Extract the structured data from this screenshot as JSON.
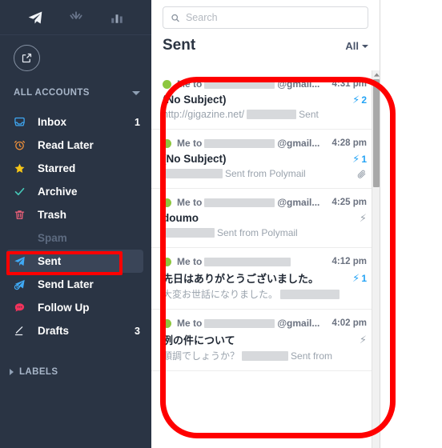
{
  "sidebar": {
    "top_icons": [
      {
        "name": "mail-icon",
        "glyph": "send",
        "active": true
      },
      {
        "name": "contacts-icon",
        "glyph": "contacts",
        "active": false
      },
      {
        "name": "stats-icon",
        "glyph": "stats",
        "active": false
      }
    ],
    "compose": {
      "label": "Compose",
      "icon": "compose-icon"
    },
    "accounts": {
      "label": "ALL ACCOUNTS"
    },
    "items": [
      {
        "label": "Inbox",
        "icon": "inbox-icon",
        "color": "#3fa9f5",
        "count": "1",
        "active": false,
        "dim": false
      },
      {
        "label": "Read Later",
        "icon": "clock-icon",
        "color": "#f0903a",
        "count": "",
        "active": false,
        "dim": false
      },
      {
        "label": "Starred",
        "icon": "star-icon",
        "color": "#f5c518",
        "count": "",
        "active": false,
        "dim": false
      },
      {
        "label": "Archive",
        "icon": "check-icon",
        "color": "#46c8b8",
        "count": "",
        "active": false,
        "dim": false
      },
      {
        "label": "Trash",
        "icon": "trash-icon",
        "color": "#f0607a",
        "count": "",
        "active": false,
        "dim": false
      },
      {
        "label": "Spam",
        "icon": "none",
        "color": "#5d6b80",
        "count": "",
        "active": false,
        "dim": true
      },
      {
        "label": "Sent",
        "icon": "send-icon",
        "color": "#3fa9f5",
        "count": "",
        "active": true,
        "dim": false
      },
      {
        "label": "Send Later",
        "icon": "send-later-icon",
        "color": "#3fa9f5",
        "count": "",
        "active": false,
        "dim": false
      },
      {
        "label": "Follow Up",
        "icon": "comment-icon",
        "color": "#f0335c",
        "count": "",
        "active": false,
        "dim": false
      },
      {
        "label": "Drafts",
        "icon": "pencil-icon",
        "color": "#e8ecf2",
        "count": "3",
        "active": false,
        "dim": false
      }
    ],
    "labels": {
      "label": "LABELS"
    }
  },
  "list": {
    "search": {
      "placeholder": "Search",
      "value": "",
      "icon": "search-icon"
    },
    "title": "Sent",
    "filter": {
      "label": "All",
      "icon": "chevron-down-icon"
    },
    "messages": [
      {
        "sender": "Me to",
        "redact_width": 88,
        "domain": "@gmail...",
        "time": "4:31 pm",
        "subject": "(No Subject)",
        "preview": "http://gigazine.net/",
        "preview_redact_width": 62,
        "sent_from": "Sent",
        "bolt": "blue",
        "badge_count": "2",
        "attachment": false,
        "unread_dot": "#8dc63f"
      },
      {
        "sender": "Me to",
        "redact_width": 88,
        "domain": "@gmail...",
        "time": "4:28 pm",
        "subject": "(No Subject)",
        "preview": "",
        "preview_redact_width": 72,
        "sent_from": "Sent from Polymail",
        "bolt": "blue",
        "badge_count": "1",
        "attachment": true,
        "unread_dot": "#8dc63f"
      },
      {
        "sender": "Me to",
        "redact_width": 88,
        "domain": "@gmail...",
        "time": "4:25 pm",
        "subject": "doumo",
        "preview": "",
        "preview_redact_width": 62,
        "sent_from": "Sent from Polymail",
        "bolt": "gray",
        "badge_count": "",
        "attachment": false,
        "unread_dot": "#8dc63f"
      },
      {
        "sender": "Me to",
        "redact_width": 108,
        "domain": "",
        "time": "4:12 pm",
        "subject": "先日はありがとうございました。",
        "preview": "大変お世話になりました。",
        "preview_redact_width": 74,
        "sent_from": "",
        "bolt": "blue",
        "badge_count": "1",
        "attachment": false,
        "unread_dot": "#8dc63f"
      },
      {
        "sender": "Me to",
        "redact_width": 88,
        "domain": "@gmail...",
        "time": "4:02 pm",
        "subject": "例の件について",
        "preview": "順調でしょうか？",
        "preview_redact_width": 58,
        "sent_from": "Sent from",
        "bolt": "gray",
        "badge_count": "",
        "attachment": false,
        "unread_dot": "#8dc63f"
      }
    ]
  },
  "annotations": {
    "sent_highlight": {
      "name": "sent-annotation-rect",
      "color": "#ff0000"
    },
    "list_highlight": {
      "name": "message-list-annotation-oval",
      "color": "#ff0000"
    }
  }
}
